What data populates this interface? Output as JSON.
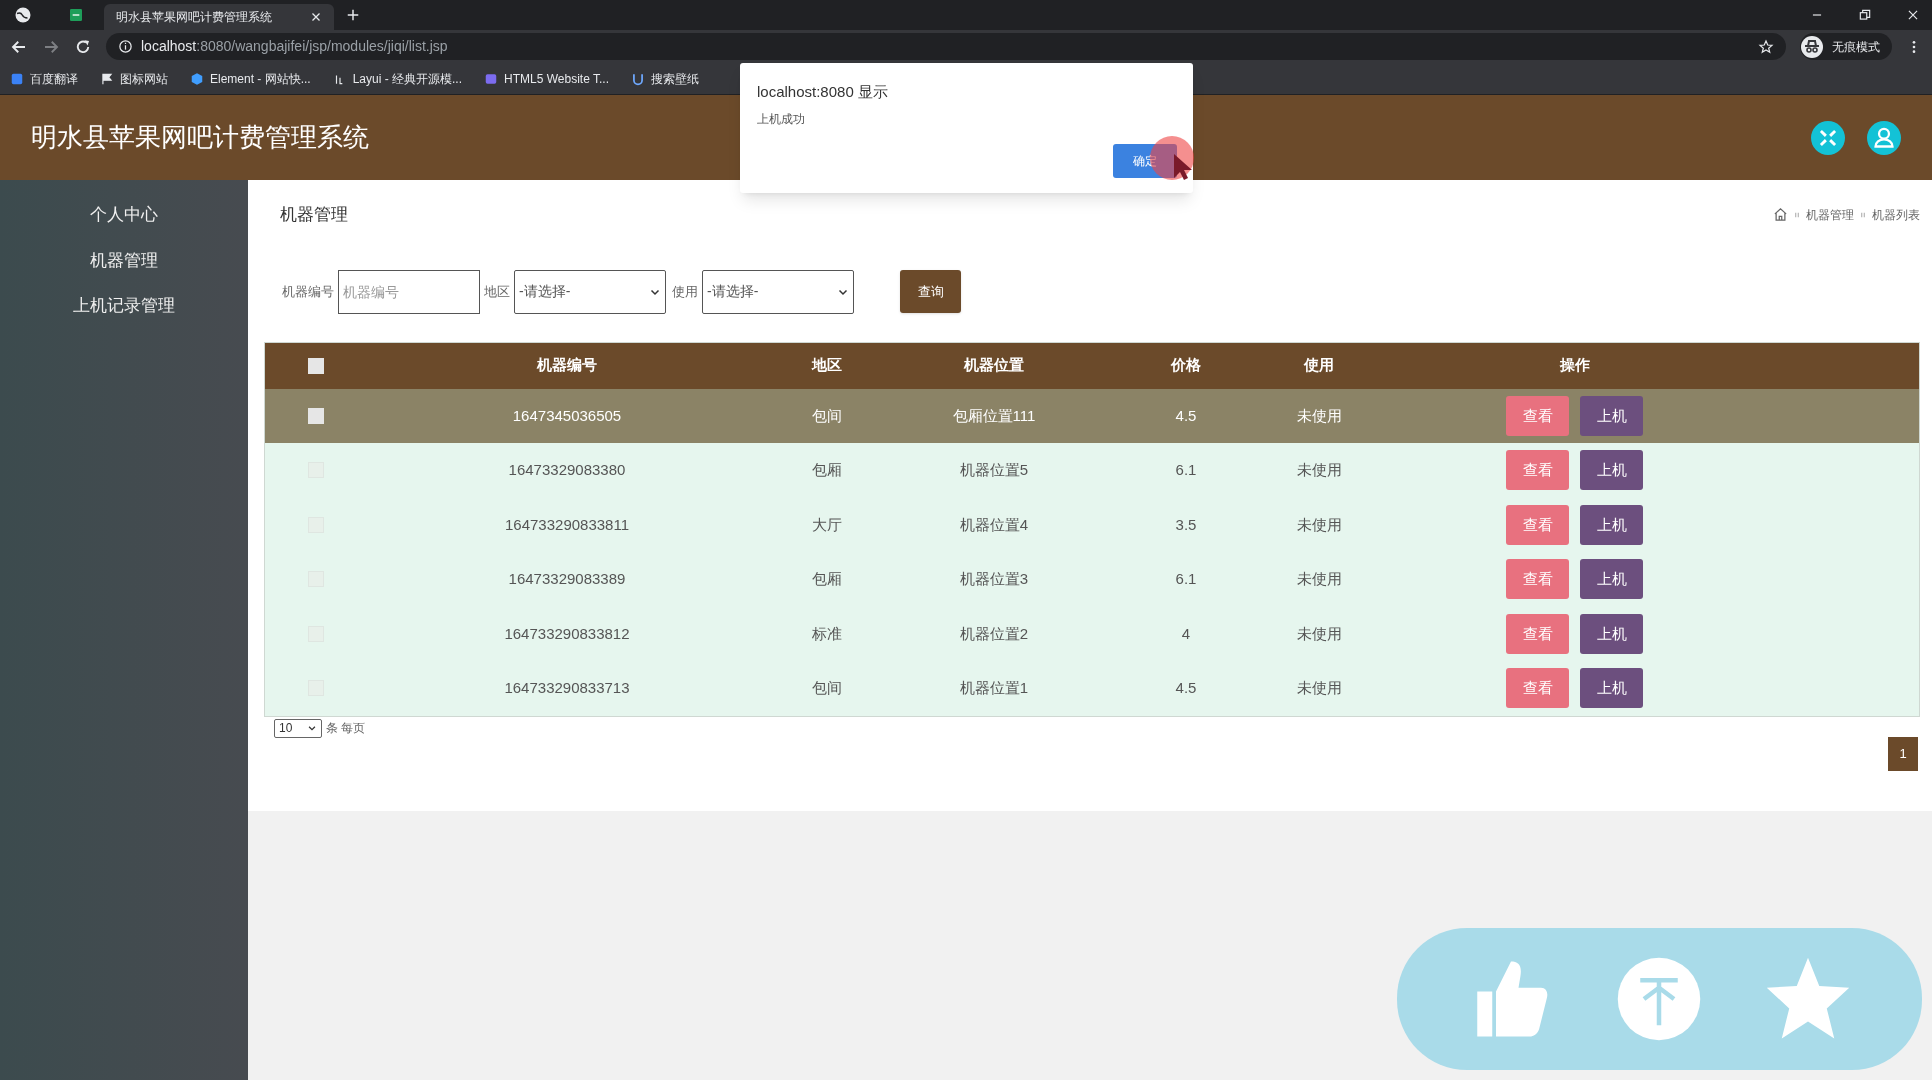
{
  "browser": {
    "tabs": [
      {
        "title": "明水县苹果网吧计费管理系统",
        "selected": true
      }
    ],
    "url_host": "localhost",
    "url_rest": ":8080/wangbajifei/jsp/modules/jiqi/list.jsp",
    "bookmarks": [
      "百度翻译",
      "图标网站",
      "Element - 网站快...",
      "Layui - 经典开源模...",
      "HTML5 Website T...",
      "搜索壁纸"
    ],
    "profile_label": "无痕模式"
  },
  "header": {
    "title": "明水县苹果网吧计费管理系统"
  },
  "sidebar": {
    "items": [
      {
        "label": "个人中心"
      },
      {
        "label": "机器管理"
      },
      {
        "label": "上机记录管理"
      }
    ]
  },
  "page_title": "机器管理",
  "breadcrumb": [
    "机器管理",
    "机器列表"
  ],
  "filters": [
    {
      "kind": "input",
      "label": "机器编号",
      "placeholder": "机器编号"
    },
    {
      "kind": "select",
      "label": "地区",
      "value": "-请选择-"
    },
    {
      "kind": "select",
      "label": "使用",
      "value": "-请选择-"
    }
  ],
  "search_button": "查询",
  "table": {
    "select_all_checked": false,
    "columns": [
      "机器编号",
      "地区",
      "机器位置",
      "价格",
      "使用",
      "操作"
    ],
    "rows": [
      {
        "cells": [
          "1647345036505",
          "包间",
          "包厢位置111",
          "4.5",
          "未使用"
        ],
        "checked": false,
        "highlighted": true,
        "actions": [
          "查看",
          "上机"
        ]
      },
      {
        "cells": [
          "16473329083380",
          "包厢",
          "机器位置5",
          "6.1",
          "未使用"
        ],
        "checked": false,
        "highlighted": false,
        "actions": [
          "查看",
          "上机"
        ]
      },
      {
        "cells": [
          "164733290833811",
          "大厅",
          "机器位置4",
          "3.5",
          "未使用"
        ],
        "checked": false,
        "highlighted": false,
        "actions": [
          "查看",
          "上机"
        ]
      },
      {
        "cells": [
          "16473329083389",
          "包厢",
          "机器位置3",
          "6.1",
          "未使用"
        ],
        "checked": false,
        "highlighted": false,
        "actions": [
          "查看",
          "上机"
        ]
      },
      {
        "cells": [
          "164733290833812",
          "标准",
          "机器位置2",
          "4",
          "未使用"
        ],
        "checked": false,
        "highlighted": false,
        "actions": [
          "查看",
          "上机"
        ]
      },
      {
        "cells": [
          "164733290833713",
          "包间",
          "机器位置1",
          "4.5",
          "未使用"
        ],
        "checked": false,
        "highlighted": false,
        "actions": [
          "查看",
          "上机"
        ]
      }
    ]
  },
  "pagination": {
    "page_size": "10",
    "page_size_suffix": "条 每页",
    "pages": [
      {
        "label": "1",
        "selected": true
      }
    ]
  },
  "dialog": {
    "title": "localhost:8080 显示",
    "message": "上机成功",
    "button": "确定"
  }
}
